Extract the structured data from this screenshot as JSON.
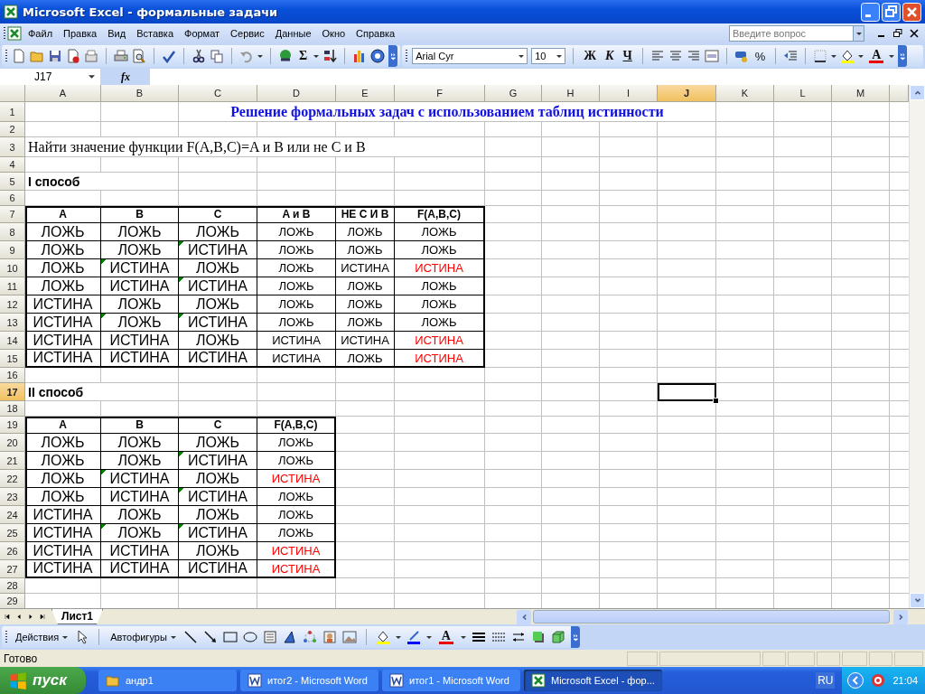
{
  "window": {
    "title": "Microsoft Excel - формальные задачи"
  },
  "menu": [
    {
      "label": "Файл"
    },
    {
      "label": "Правка"
    },
    {
      "label": "Вид"
    },
    {
      "label": "Вставка"
    },
    {
      "label": "Формат"
    },
    {
      "label": "Сервис"
    },
    {
      "label": "Данные"
    },
    {
      "label": "Окно"
    },
    {
      "label": "Справка"
    }
  ],
  "help_search": {
    "placeholder": "Введите вопрос"
  },
  "standard_toolbar": {
    "sum_label": "Σ"
  },
  "formatting_toolbar": {
    "font": "Arial Cyr",
    "size": "10",
    "bold_label": "Ж",
    "italic_label": "К",
    "underline_label": "Ч",
    "percent_label": "%",
    "font_color_label": "A"
  },
  "formula_bar": {
    "name_box": "J17",
    "function_label": "fx"
  },
  "sheet": {
    "columns": [
      {
        "label": "A",
        "selected": false
      },
      {
        "label": "B",
        "selected": false
      },
      {
        "label": "C",
        "selected": false
      },
      {
        "label": "D",
        "selected": false
      },
      {
        "label": "E",
        "selected": false
      },
      {
        "label": "F",
        "selected": false
      },
      {
        "label": "G",
        "selected": false
      },
      {
        "label": "H",
        "selected": false
      },
      {
        "label": "I",
        "selected": false
      },
      {
        "label": "J",
        "selected": true
      },
      {
        "label": "K",
        "selected": false
      },
      {
        "label": "L",
        "selected": false
      },
      {
        "label": "M",
        "selected": false
      }
    ],
    "rows": [
      {
        "number": "1",
        "kind": "title",
        "selected": false,
        "text": "Решение формальных задач с использованием таблиц истинности"
      },
      {
        "number": "2",
        "kind": "blank",
        "selected": false
      },
      {
        "number": "3",
        "kind": "text",
        "selected": false,
        "text": "Найти значение функции F(A,B,C)=A и B или не C и B"
      },
      {
        "number": "4",
        "kind": "blank",
        "selected": false
      },
      {
        "number": "5",
        "kind": "section",
        "selected": false,
        "text": "I способ"
      },
      {
        "number": "6",
        "kind": "blank",
        "selected": false
      },
      {
        "number": "7",
        "kind": "head",
        "selected": false,
        "cells": [
          {
            "text": "A"
          },
          {
            "text": "B"
          },
          {
            "text": "C"
          },
          {
            "text": "A и B"
          },
          {
            "text": "НЕ  С И В"
          },
          {
            "text": "F(A,B,C)"
          }
        ]
      },
      {
        "number": "8",
        "kind": "data",
        "selected": false,
        "cells": [
          {
            "text": "ЛОЖЬ",
            "flagged": false
          },
          {
            "text": "ЛОЖЬ",
            "flagged": false
          },
          {
            "text": "ЛОЖЬ",
            "flagged": false
          },
          {
            "text": "ЛОЖЬ",
            "flagged": false
          },
          {
            "text": "ЛОЖЬ",
            "flagged": false
          },
          {
            "text": "ЛОЖЬ",
            "flagged": false,
            "color": "#000000"
          }
        ]
      },
      {
        "number": "9",
        "kind": "data",
        "selected": false,
        "cells": [
          {
            "text": "ЛОЖЬ",
            "flagged": false
          },
          {
            "text": "ЛОЖЬ",
            "flagged": false
          },
          {
            "text": "ИСТИНА",
            "flagged": true
          },
          {
            "text": "ЛОЖЬ",
            "flagged": false
          },
          {
            "text": "ЛОЖЬ",
            "flagged": false
          },
          {
            "text": "ЛОЖЬ",
            "flagged": false,
            "color": "#000000"
          }
        ]
      },
      {
        "number": "10",
        "kind": "data",
        "selected": false,
        "cells": [
          {
            "text": "ЛОЖЬ",
            "flagged": false
          },
          {
            "text": "ИСТИНА",
            "flagged": true
          },
          {
            "text": "ЛОЖЬ",
            "flagged": false
          },
          {
            "text": "ЛОЖЬ",
            "flagged": false
          },
          {
            "text": "ИСТИНА",
            "flagged": false
          },
          {
            "text": "ИСТИНА",
            "flagged": false,
            "color": "#ff0000"
          }
        ]
      },
      {
        "number": "11",
        "kind": "data",
        "selected": false,
        "cells": [
          {
            "text": "ЛОЖЬ",
            "flagged": false
          },
          {
            "text": "ИСТИНА",
            "flagged": false
          },
          {
            "text": "ИСТИНА",
            "flagged": true
          },
          {
            "text": "ЛОЖЬ",
            "flagged": false
          },
          {
            "text": "ЛОЖЬ",
            "flagged": false
          },
          {
            "text": "ЛОЖЬ",
            "flagged": false,
            "color": "#000000"
          }
        ]
      },
      {
        "number": "12",
        "kind": "data",
        "selected": false,
        "cells": [
          {
            "text": "ИСТИНА",
            "flagged": false
          },
          {
            "text": "ЛОЖЬ",
            "flagged": false
          },
          {
            "text": "ЛОЖЬ",
            "flagged": false
          },
          {
            "text": "ЛОЖЬ",
            "flagged": false
          },
          {
            "text": "ЛОЖЬ",
            "flagged": false
          },
          {
            "text": "ЛОЖЬ",
            "flagged": false,
            "color": "#000000"
          }
        ]
      },
      {
        "number": "13",
        "kind": "data",
        "selected": false,
        "cells": [
          {
            "text": "ИСТИНА",
            "flagged": false
          },
          {
            "text": "ЛОЖЬ",
            "flagged": true
          },
          {
            "text": "ИСТИНА",
            "flagged": true
          },
          {
            "text": "ЛОЖЬ",
            "flagged": false
          },
          {
            "text": "ЛОЖЬ",
            "flagged": false
          },
          {
            "text": "ЛОЖЬ",
            "flagged": false,
            "color": "#000000"
          }
        ]
      },
      {
        "number": "14",
        "kind": "data",
        "selected": false,
        "cells": [
          {
            "text": "ИСТИНА",
            "flagged": false
          },
          {
            "text": "ИСТИНА",
            "flagged": false
          },
          {
            "text": "ЛОЖЬ",
            "flagged": false
          },
          {
            "text": "ИСТИНА",
            "flagged": false
          },
          {
            "text": "ИСТИНА",
            "flagged": false
          },
          {
            "text": "ИСТИНА",
            "flagged": false,
            "color": "#ff0000"
          }
        ]
      },
      {
        "number": "15",
        "kind": "data",
        "selected": false,
        "cells": [
          {
            "text": "ИСТИНА",
            "flagged": false
          },
          {
            "text": "ИСТИНА",
            "flagged": false
          },
          {
            "text": "ИСТИНА",
            "flagged": false
          },
          {
            "text": "ИСТИНА",
            "flagged": false
          },
          {
            "text": "ЛОЖЬ",
            "flagged": false
          },
          {
            "text": "ИСТИНА",
            "flagged": false,
            "color": "#ff0000"
          }
        ]
      },
      {
        "number": "16",
        "kind": "blank",
        "selected": false
      },
      {
        "number": "17",
        "kind": "section",
        "selected": true,
        "text": "II способ"
      },
      {
        "number": "18",
        "kind": "blank",
        "selected": false
      },
      {
        "number": "19",
        "kind": "head",
        "selected": false,
        "cells": [
          {
            "text": "A"
          },
          {
            "text": "B"
          },
          {
            "text": "C"
          },
          {
            "text": "F(A,B,C)"
          }
        ]
      },
      {
        "number": "20",
        "kind": "data",
        "selected": false,
        "cells": [
          {
            "text": "ЛОЖЬ",
            "flagged": false
          },
          {
            "text": "ЛОЖЬ",
            "flagged": false
          },
          {
            "text": "ЛОЖЬ",
            "flagged": false
          },
          {
            "text": "ЛОЖЬ",
            "flagged": false,
            "color": "#000000"
          }
        ]
      },
      {
        "number": "21",
        "kind": "data",
        "selected": false,
        "cells": [
          {
            "text": "ЛОЖЬ",
            "flagged": false
          },
          {
            "text": "ЛОЖЬ",
            "flagged": false
          },
          {
            "text": "ИСТИНА",
            "flagged": true
          },
          {
            "text": "ЛОЖЬ",
            "flagged": false,
            "color": "#000000"
          }
        ]
      },
      {
        "number": "22",
        "kind": "data",
        "selected": false,
        "cells": [
          {
            "text": "ЛОЖЬ",
            "flagged": false
          },
          {
            "text": "ИСТИНА",
            "flagged": true
          },
          {
            "text": "ЛОЖЬ",
            "flagged": false
          },
          {
            "text": "ИСТИНА",
            "flagged": false,
            "color": "#ff0000"
          }
        ]
      },
      {
        "number": "23",
        "kind": "data",
        "selected": false,
        "cells": [
          {
            "text": "ЛОЖЬ",
            "flagged": false
          },
          {
            "text": "ИСТИНА",
            "flagged": false
          },
          {
            "text": "ИСТИНА",
            "flagged": true
          },
          {
            "text": "ЛОЖЬ",
            "flagged": false,
            "color": "#000000"
          }
        ]
      },
      {
        "number": "24",
        "kind": "data",
        "selected": false,
        "cells": [
          {
            "text": "ИСТИНА",
            "flagged": false
          },
          {
            "text": "ЛОЖЬ",
            "flagged": false
          },
          {
            "text": "ЛОЖЬ",
            "flagged": false
          },
          {
            "text": "ЛОЖЬ",
            "flagged": false,
            "color": "#000000"
          }
        ]
      },
      {
        "number": "25",
        "kind": "data",
        "selected": false,
        "cells": [
          {
            "text": "ИСТИНА",
            "flagged": false
          },
          {
            "text": "ЛОЖЬ",
            "flagged": true
          },
          {
            "text": "ИСТИНА",
            "flagged": true
          },
          {
            "text": "ЛОЖЬ",
            "flagged": false,
            "color": "#000000"
          }
        ]
      },
      {
        "number": "26",
        "kind": "data",
        "selected": false,
        "cells": [
          {
            "text": "ИСТИНА",
            "flagged": false
          },
          {
            "text": "ИСТИНА",
            "flagged": false
          },
          {
            "text": "ЛОЖЬ",
            "flagged": false
          },
          {
            "text": "ИСТИНА",
            "flagged": false,
            "color": "#ff0000"
          }
        ]
      },
      {
        "number": "27",
        "kind": "data",
        "selected": false,
        "cells": [
          {
            "text": "ИСТИНА",
            "flagged": false
          },
          {
            "text": "ИСТИНА",
            "flagged": false
          },
          {
            "text": "ИСТИНА",
            "flagged": false
          },
          {
            "text": "ИСТИНА",
            "flagged": false,
            "color": "#ff0000"
          }
        ]
      },
      {
        "number": "28",
        "kind": "blank",
        "selected": false
      },
      {
        "number": "29",
        "kind": "blank",
        "selected": false
      }
    ]
  },
  "sheet_tabs": [
    {
      "label": "Лист1",
      "selected": true
    }
  ],
  "drawing_toolbar": {
    "actions": "Действия",
    "autoshapes": "Автофигуры",
    "font_color_label": "A"
  },
  "status_bar": {
    "text": "Готово"
  },
  "taskbar": {
    "start": "пуск",
    "buttons": [
      {
        "label": "андр1",
        "kind": "folder",
        "selected": false
      },
      {
        "label": "итог2 - Microsoft Word",
        "kind": "word",
        "selected": false
      },
      {
        "label": "итог1 - Microsoft Word",
        "kind": "word",
        "selected": false
      },
      {
        "label": "Microsoft Excel - фор...",
        "kind": "excel",
        "selected": true
      }
    ],
    "language": "RU",
    "clock": "21:04"
  }
}
